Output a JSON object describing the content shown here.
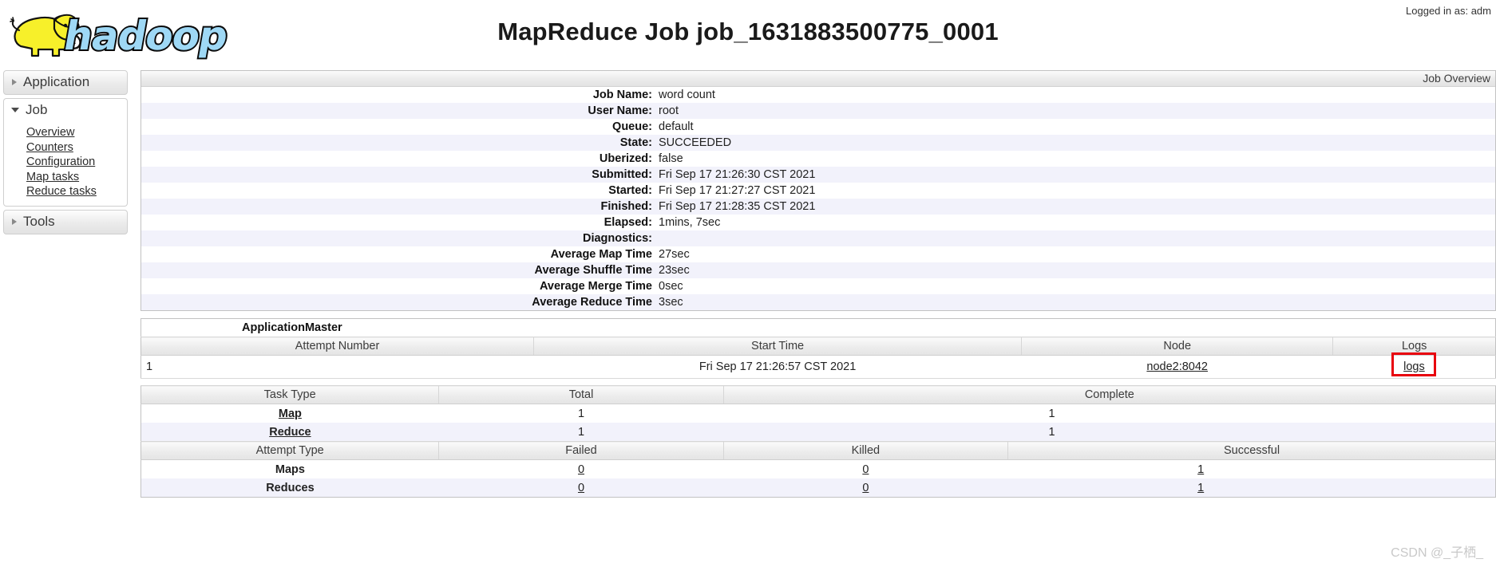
{
  "header": {
    "title": "MapReduce Job job_1631883500775_0001",
    "logged_in_as": "Logged in as: adm",
    "logo_alt": "hadoop"
  },
  "sidebar": {
    "sections": [
      {
        "label": "Application",
        "expanded": false,
        "icon": "chevron-right-icon",
        "items": []
      },
      {
        "label": "Job",
        "expanded": true,
        "icon": "chevron-down-icon",
        "items": [
          "Overview",
          "Counters",
          "Configuration",
          "Map tasks",
          "Reduce tasks"
        ]
      },
      {
        "label": "Tools",
        "expanded": false,
        "icon": "chevron-right-icon",
        "items": []
      }
    ]
  },
  "overview": {
    "caption": "Job Overview",
    "rows": [
      {
        "key": "Job Name:",
        "value": "word count"
      },
      {
        "key": "User Name:",
        "value": "root"
      },
      {
        "key": "Queue:",
        "value": "default"
      },
      {
        "key": "State:",
        "value": "SUCCEEDED"
      },
      {
        "key": "Uberized:",
        "value": "false"
      },
      {
        "key": "Submitted:",
        "value": "Fri Sep 17 21:26:30 CST 2021"
      },
      {
        "key": "Started:",
        "value": "Fri Sep 17 21:27:27 CST 2021"
      },
      {
        "key": "Finished:",
        "value": "Fri Sep 17 21:28:35 CST 2021"
      },
      {
        "key": "Elapsed:",
        "value": "1mins, 7sec"
      },
      {
        "key": "Diagnostics:",
        "value": ""
      },
      {
        "key": "Average Map Time",
        "value": "27sec"
      },
      {
        "key": "Average Shuffle Time",
        "value": "23sec"
      },
      {
        "key": "Average Merge Time",
        "value": "0sec"
      },
      {
        "key": "Average Reduce Time",
        "value": "3sec"
      }
    ]
  },
  "application_master": {
    "title": "ApplicationMaster",
    "columns": [
      "Attempt Number",
      "Start Time",
      "Node",
      "Logs"
    ],
    "row": {
      "attempt_number": "1",
      "start_time": "Fri Sep 17 21:26:57 CST 2021",
      "node": "node2:8042",
      "logs": "logs"
    },
    "highlight_color": "#e8000d"
  },
  "task_summary": {
    "columns": [
      "Task Type",
      "Total",
      "Complete"
    ],
    "rows": [
      {
        "type": "Map",
        "total": "1",
        "complete": "1"
      },
      {
        "type": "Reduce",
        "total": "1",
        "complete": "1"
      }
    ]
  },
  "attempt_summary": {
    "columns": [
      "Attempt Type",
      "Failed",
      "Killed",
      "Successful"
    ],
    "rows": [
      {
        "type": "Maps",
        "failed": "0",
        "killed": "0",
        "successful": "1"
      },
      {
        "type": "Reduces",
        "failed": "0",
        "killed": "0",
        "successful": "1"
      }
    ]
  },
  "watermark": "CSDN @_子栖_"
}
